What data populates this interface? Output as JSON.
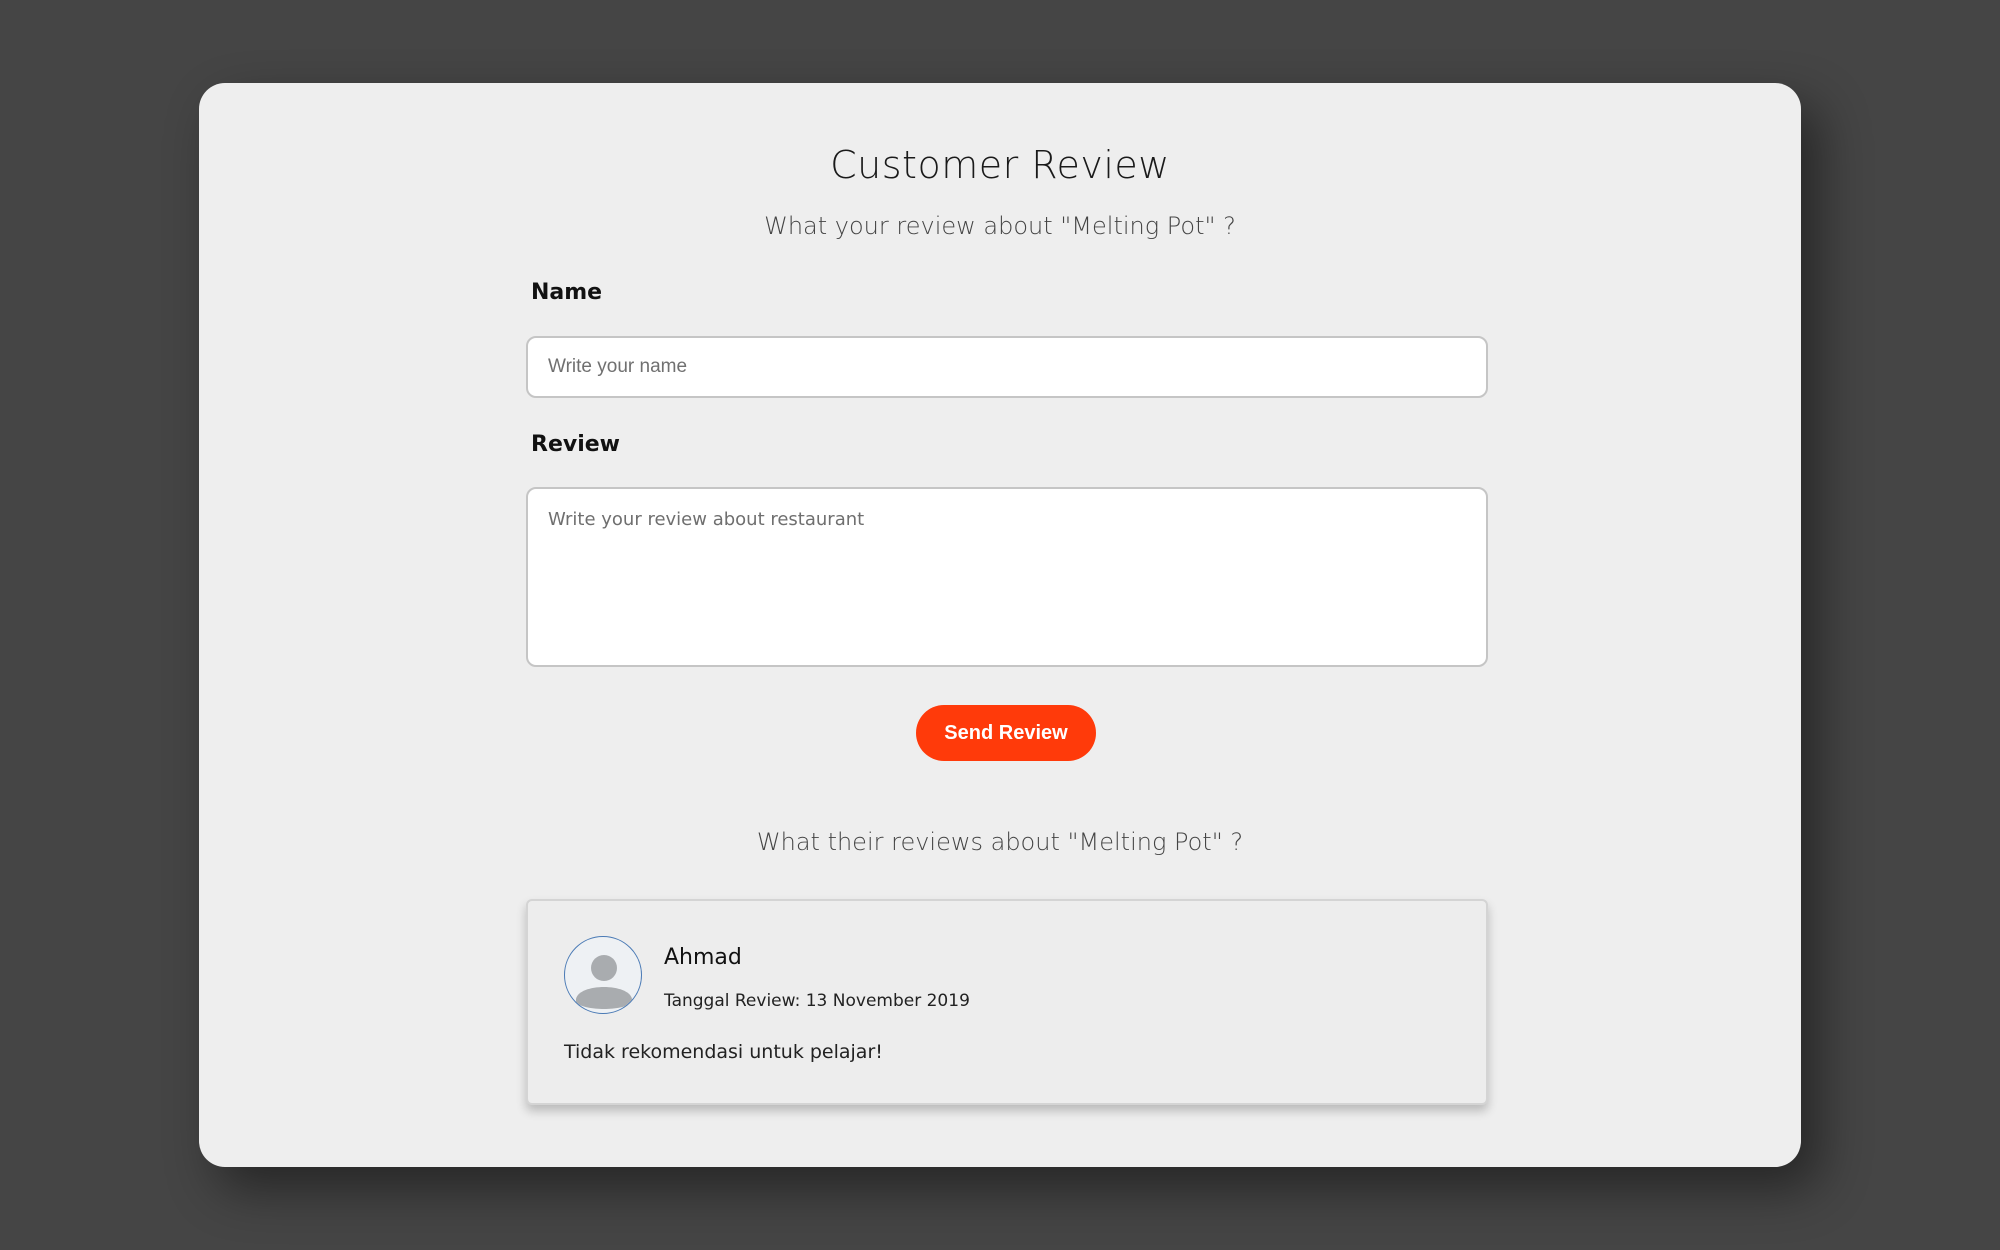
{
  "title": "Customer Review",
  "subtitle_form": "What your review about \"Melting Pot\" ?",
  "form": {
    "name_label": "Name",
    "name_placeholder": "Write your name",
    "name_value": "",
    "review_label": "Review",
    "review_placeholder": "Write your review about restaurant",
    "review_value": "",
    "submit_label": "Send Review"
  },
  "subtitle_reviews": "What their reviews about \"Melting Pot\" ?",
  "reviews": [
    {
      "name": "Ahmad",
      "date": "Tanggal Review: 13 November 2019",
      "text": "Tidak rekomendasi untuk pelajar!",
      "avatar_icon": "user-avatar-icon"
    }
  ],
  "colors": {
    "background": "#454545",
    "card": "#eeeeee",
    "accent": "#ff3a0a",
    "avatar_border": "#4a7ab5"
  }
}
